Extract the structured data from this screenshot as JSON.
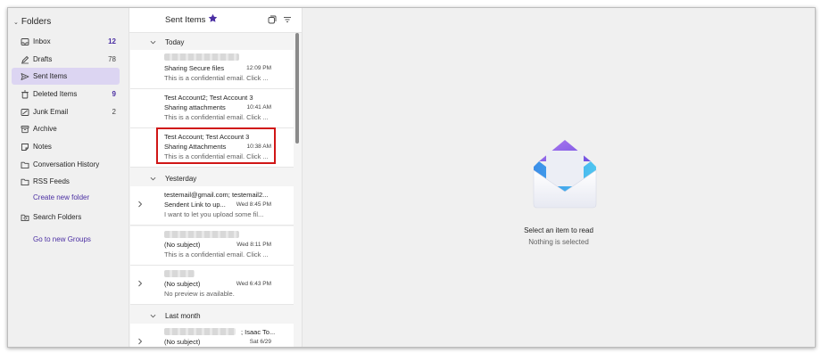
{
  "folders": {
    "header": "Folders",
    "items": [
      {
        "label": "Inbox",
        "count": "12",
        "icon": "inbox-icon"
      },
      {
        "label": "Drafts",
        "count": "78",
        "icon": "pencil-icon"
      },
      {
        "label": "Sent Items",
        "count": "",
        "icon": "send-icon"
      },
      {
        "label": "Deleted Items",
        "count": "9",
        "icon": "trash-icon"
      },
      {
        "label": "Junk Email",
        "count": "2",
        "icon": "junk-icon"
      },
      {
        "label": "Archive",
        "count": "",
        "icon": "archive-icon"
      },
      {
        "label": "Notes",
        "count": "",
        "icon": "note-icon"
      },
      {
        "label": "Conversation History",
        "count": "",
        "icon": "folder-icon"
      },
      {
        "label": "RSS Feeds",
        "count": "",
        "icon": "folder-icon"
      }
    ],
    "create_new_folder": "Create new folder",
    "search_folders": "Search Folders",
    "go_to_groups": "Go to new Groups"
  },
  "message_list": {
    "title": "Sent Items",
    "groups": {
      "today": "Today",
      "yesterday": "Yesterday",
      "last_month": "Last month"
    },
    "messages": [
      {
        "from": "",
        "subject": "Sharing Secure files",
        "time": "12:09 PM",
        "preview": "This is a confidential email. Click ..."
      },
      {
        "from": "Test Account2; Test Account 3",
        "subject": "Sharing attachments",
        "time": "10:41 AM",
        "preview": "This is a confidential email. Click ..."
      },
      {
        "from": "Test Account; Test Account 3",
        "subject": "Sharing Attachments",
        "time": "10:38 AM",
        "preview": "This is a confidential email. Click ..."
      },
      {
        "from": "testemail@gmail.com; testemail2...",
        "subject": "Sendent Link to up...",
        "time": "Wed 8:45 PM",
        "preview": "I want to let you upload some fil..."
      },
      {
        "from": "",
        "subject": "(No subject)",
        "time": "Wed 8:11 PM",
        "preview": "This is a confidential email. Click ..."
      },
      {
        "from": "",
        "subject": "(No subject)",
        "time": "Wed 6:43 PM",
        "preview": "No preview is available."
      },
      {
        "from": "; Isaac To...",
        "subject": "(No subject)",
        "time": "Sat 6/29",
        "preview": ""
      }
    ]
  },
  "reading_pane": {
    "title": "Select an item to read",
    "subtitle": "Nothing is selected"
  },
  "colors": {
    "accent": "#4b2fa3",
    "selected_bg": "#dcd5f2",
    "highlight": "#d01616"
  }
}
